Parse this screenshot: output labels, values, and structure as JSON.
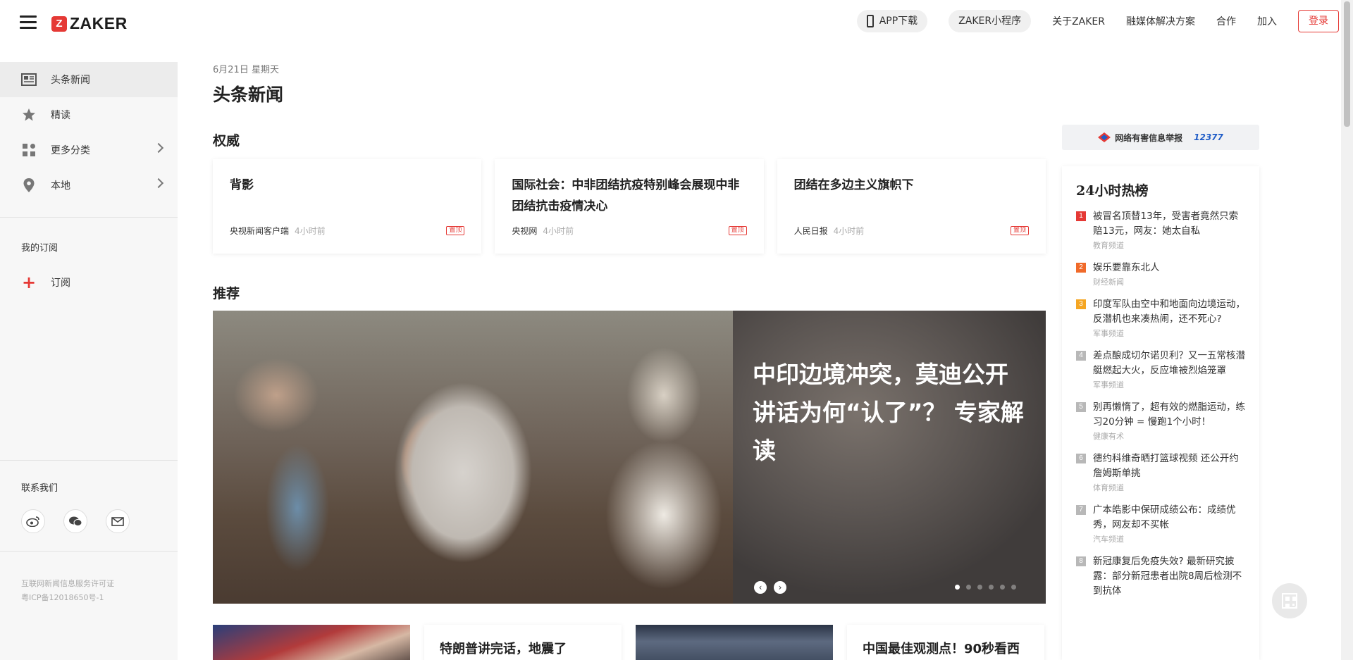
{
  "header": {
    "logo_text": "ZAKER",
    "logo_mark": "Z",
    "app_download": "APP下载",
    "mini_program": "ZAKER小程序",
    "links": [
      "关于ZAKER",
      "融媒体解决方案",
      "合作",
      "加入"
    ],
    "login": "登录"
  },
  "sidebar": {
    "items": [
      {
        "label": "头条新闻",
        "icon": "newspaper-icon"
      },
      {
        "label": "精读",
        "icon": "star-icon"
      },
      {
        "label": "更多分类",
        "icon": "grid-icon"
      },
      {
        "label": "本地",
        "icon": "location-pin-icon"
      }
    ],
    "my_subscriptions": "我的订阅",
    "subscribe": "订阅",
    "contact_title": "联系我们",
    "license_line1": "互联网新闻信息服务许可证",
    "license_line2": "粤ICP备12018650号-1"
  },
  "main": {
    "date": "6月21日 星期天",
    "title": "头条新闻",
    "authority_title": "权威",
    "authority_cards": [
      {
        "title": "背影",
        "source": "央视新闻客户端",
        "time": "4小时前",
        "tag": "置顶"
      },
      {
        "title": "国际社会：中非团结抗疫特别峰会展现中非团结抗击疫情决心",
        "source": "央视网",
        "time": "4小时前",
        "tag": "置顶"
      },
      {
        "title": "团结在多边主义旗帜下",
        "source": "人民日报",
        "time": "4小时前",
        "tag": "置顶"
      }
    ],
    "recommend_title": "推荐",
    "hero_headline": "中印边境冲突，莫迪公开讲话为何“认了”？ 专家解读",
    "hero_prev": "‹",
    "hero_next": "›",
    "bottom_cards": [
      "特朗普讲完话，地震了",
      "中国最佳观测点！90秒看西"
    ]
  },
  "right": {
    "report_text": "网络有害信息举报",
    "report_number": "12377",
    "hot_title": "24小时热榜",
    "hot_list": [
      {
        "rank": "1",
        "text": "被冒名顶替13年，受害者竟然只索赔13元，网友：她太自私",
        "source": "教育频道"
      },
      {
        "rank": "2",
        "text": "娱乐要靠东北人",
        "source": "财经新闻"
      },
      {
        "rank": "3",
        "text": "印度军队由空中和地面向边境运动，反潜机也来凑热闹，还不死心?",
        "source": "军事频道"
      },
      {
        "rank": "4",
        "text": "差点酿成切尔诺贝利？又一五常核潜艇燃起大火，反应堆被烈焰笼罩",
        "source": "军事频道"
      },
      {
        "rank": "5",
        "text": "别再懒惰了，超有效的燃脂运动，练习20分钟 = 慢跑1个小时！",
        "source": "健康有术"
      },
      {
        "rank": "6",
        "text": "德约科维奇晒打篮球视频 还公开约詹姆斯单挑",
        "source": "体育频道"
      },
      {
        "rank": "7",
        "text": "广本皓影中保研成绩公布：成绩优秀，网友却不买帐",
        "source": "汽车频道"
      },
      {
        "rank": "8",
        "text": "新冠康复后免疫失效? 最新研究披露：部分新冠患者出院8周后检测不到抗体",
        "source": ""
      }
    ]
  },
  "colors": {
    "accent": "#e53935"
  }
}
